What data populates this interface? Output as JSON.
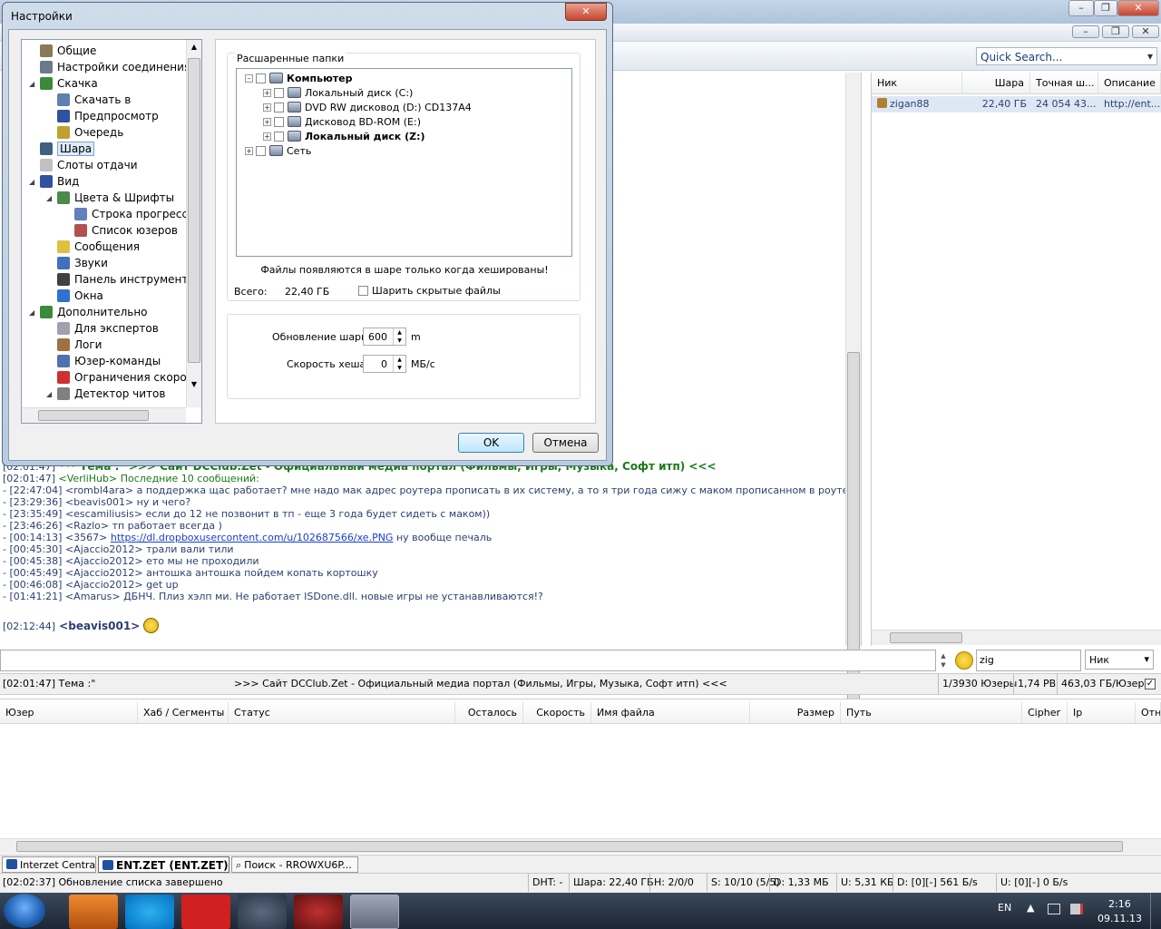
{
  "main": {
    "quick_search": "Quick Search...",
    "userlist_headers": [
      "Ник",
      "Шара",
      "Точная ш...",
      "Описание"
    ],
    "user": {
      "nick": "zigan88",
      "share": "22,40 ГБ",
      "exact": "24 054 43...",
      "desc": "http://ent..."
    },
    "chat": [
      {
        "ts": "[02:01:47]",
        "text": " *** Тема :\"          >>> Сайт DCClub.Zet - Официальный медиа портал (Фильмы, Игры, Музыка, Софт итп) <<<"
      },
      {
        "ts": "[02:01:47]",
        "text": " <VerliHub> Последние 10 сообщений:"
      },
      {
        "ts": "- [22:47:04]",
        "text": " <rombl4ara> а поддержка щас работает? мне надо мак адрес роутера прописать в их систему, а то я три года сижу с маком прописанном в роутере от старой материнки"
      },
      {
        "ts": "- [23:29:36]",
        "text": " <beavis001> ну и чего?"
      },
      {
        "ts": "- [23:35:49]",
        "text": " <escamiliusis> если до 12 не позвонит в тп - еще 3 года будет сидеть с маком))"
      },
      {
        "ts": "- [23:46:26]",
        "text": " <Razlo> тп работает всегда )"
      },
      {
        "ts": "- [00:14:13]",
        "text": " <3567> ",
        "link": "https://dl.dropboxusercontent.com/u/102687566/xe.PNG",
        "after": " ну вообще печаль"
      },
      {
        "ts": "- [00:45:30]",
        "text": " <Ajaccio2012> трали вали тили"
      },
      {
        "ts": "- [00:45:38]",
        "text": " <Ajaccio2012> ето мы не проходили"
      },
      {
        "ts": "- [00:45:49]",
        "text": " <Ajaccio2012> антошка антошка пойдем копать кортошку"
      },
      {
        "ts": "- [00:46:08]",
        "text": " <Ajaccio2012> get up"
      },
      {
        "ts": "- [01:41:21]",
        "text": " <Amarus> ДБНЧ. Плиз хэлп ми. Не работает ISDone.dll. новые игры не устанавливаются!?"
      }
    ],
    "last_msg": {
      "ts": "[02:12:44]",
      "nick": " <beavis001>"
    },
    "nick_filter": "zig",
    "filter_select": "Ник",
    "topic_ts": "[02:01:47] Тема :\"",
    "topic": ">>> Сайт DCClub.Zet - Официальный медиа портал (Фильмы, Игры, Музыка, Софт итп) <<<",
    "users_count": "1/3930 Юзеры",
    "hub_share": "1,74 PB",
    "per_user": "463,03 ГБ/Юзер",
    "transfer_headers": [
      "Юзер",
      "Хаб / Сегменты",
      "Статус",
      "Осталось",
      "Скорость",
      "Имя файла",
      "Размер",
      "Путь",
      "Cipher",
      "Ip",
      "Отн"
    ],
    "tabs": [
      "Interzet Central...",
      "ENT.ZET (ENT.ZET)",
      "Поиск - RROWXU6P..."
    ],
    "status": {
      "msg": "[02:02:37] Обновление списка завершено",
      "dht": "DHT: -",
      "share": "Шара: 22,40 ГБ",
      "h": "H: 2/0/0",
      "s": "S: 10/10 (5/5)",
      "d": "D: 1,33 МБ",
      "u": "U: 5,31 КБ",
      "dr": "D: [0][-] 561 Б/s",
      "ur": "U: [0][-] 0 Б/s"
    }
  },
  "dialog": {
    "title": "Настройки",
    "tree": [
      {
        "label": "Общие",
        "lvl": 1,
        "c": "#8a7a5a"
      },
      {
        "label": "Настройки соединения",
        "lvl": 1,
        "c": "#6a7a8a"
      },
      {
        "label": "Скачка",
        "lvl": 1,
        "c": "#3a8a3a",
        "exp": true
      },
      {
        "label": "Скачать в",
        "lvl": 2,
        "c": "#6080b0"
      },
      {
        "label": "Предпросмотр",
        "lvl": 2,
        "c": "#3050a0"
      },
      {
        "label": "Очередь",
        "lvl": 2,
        "c": "#c0a030"
      },
      {
        "label": "Шара",
        "lvl": 1,
        "c": "#406080",
        "sel": true
      },
      {
        "label": "Слоты отдачи",
        "lvl": 1,
        "c": "#c0c0c0"
      },
      {
        "label": "Вид",
        "lvl": 1,
        "c": "#3050a0",
        "exp": true
      },
      {
        "label": "Цвета & Шрифты",
        "lvl": 2,
        "c": "#4a8a4a",
        "exp": true
      },
      {
        "label": "Строка прогресса",
        "lvl": 3,
        "c": "#6080c0"
      },
      {
        "label": "Список юзеров",
        "lvl": 3,
        "c": "#b05050"
      },
      {
        "label": "Сообщения",
        "lvl": 2,
        "c": "#e0c040"
      },
      {
        "label": "Звуки",
        "lvl": 2,
        "c": "#4070c0"
      },
      {
        "label": "Панель инструменто",
        "lvl": 2,
        "c": "#404040"
      },
      {
        "label": "Окна",
        "lvl": 2,
        "c": "#3070d0"
      },
      {
        "label": "Дополнительно",
        "lvl": 1,
        "c": "#3a8a3a",
        "exp": true
      },
      {
        "label": "Для экспертов",
        "lvl": 2,
        "c": "#a0a0b0"
      },
      {
        "label": "Логи",
        "lvl": 2,
        "c": "#a07040"
      },
      {
        "label": "Юзер-команды",
        "lvl": 2,
        "c": "#5070b0"
      },
      {
        "label": "Ограничения скорос",
        "lvl": 2,
        "c": "#d03030"
      },
      {
        "label": "Детектор читов",
        "lvl": 2,
        "c": "#808080",
        "exp": true
      }
    ],
    "group_title": "Расшаренные папки",
    "folders": [
      {
        "label": "Компьютер",
        "bold": true,
        "lvl": 0,
        "exp": true
      },
      {
        "label": "Локальный диск (C:)",
        "lvl": 1
      },
      {
        "label": "DVD RW дисковод (D:) CD137A4",
        "lvl": 1
      },
      {
        "label": "Дисковод BD-ROM (E:)",
        "lvl": 1
      },
      {
        "label": "Локальный диск (Z:)",
        "bold": true,
        "lvl": 1
      },
      {
        "label": "Сеть",
        "lvl": 0
      }
    ],
    "notice": "Файлы появляются в шаре только когда хешированы!",
    "total_label": "Всего:",
    "total_value": "22,40 ГБ",
    "hidden_label": "Шарить скрытые файлы",
    "refresh_label": "Обновление шары",
    "refresh_value": "600",
    "refresh_unit": "m",
    "hash_label": "Скорость хеша",
    "hash_value": "0",
    "hash_unit": "МБ/с",
    "ok": "OK",
    "cancel": "Отмена"
  },
  "taskbar": {
    "lang": "EN",
    "time": "2:16",
    "date": "09.11.13"
  }
}
